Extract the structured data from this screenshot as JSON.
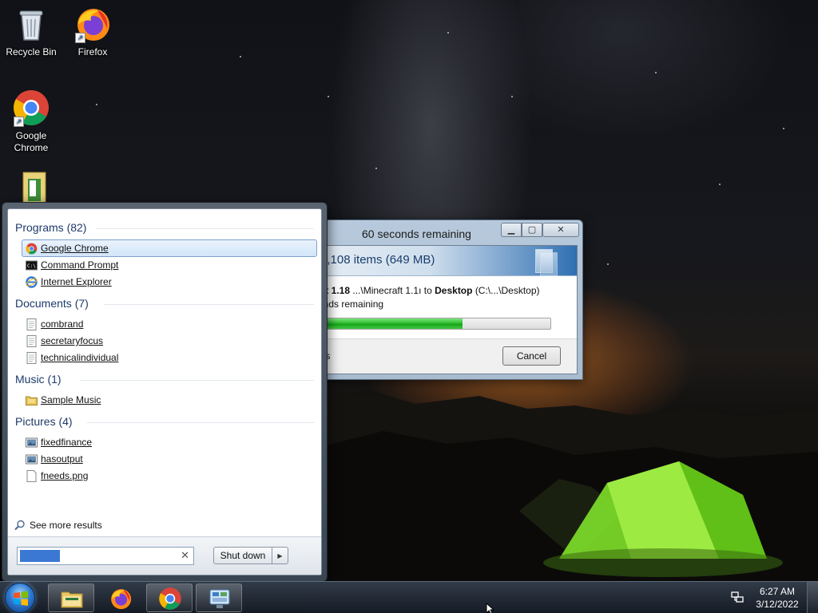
{
  "desktop": {
    "icons": [
      {
        "label": "Recycle Bin",
        "icon": "recycle-bin-icon"
      },
      {
        "label": "Firefox",
        "icon": "firefox-icon"
      },
      {
        "label": "Google Chrome",
        "icon": "chrome-icon"
      },
      {
        "label": "",
        "icon": "folder-icon"
      }
    ]
  },
  "copy_dialog": {
    "title": "60 seconds remaining",
    "heading": "4,108 items (649 MB)",
    "route": {
      "prefix": "raft 1.18",
      "source": "...\\Minecraft 1.1ı",
      "connector": "to",
      "destination": "Desktop",
      "destination_path": "(C:\\...\\Desktop)"
    },
    "remaining": "conds remaining",
    "progress_fraction": 0.63,
    "more_details": "tails",
    "cancel_label": "Cancel",
    "caption_buttons": {
      "minimize": "minimize-icon",
      "maximize": "maximize-icon",
      "close": "close-icon"
    }
  },
  "start_menu": {
    "groups": [
      {
        "header": "Programs (82)",
        "items": [
          {
            "label": "Google Chrome",
            "icon": "chrome-icon",
            "selected": true
          },
          {
            "label": "Command Prompt",
            "icon": "command-prompt-icon"
          },
          {
            "label": "Internet Explorer",
            "icon": "internet-explorer-icon"
          }
        ]
      },
      {
        "header": "Documents (7)",
        "items": [
          {
            "label": "combrand",
            "icon": "document-icon"
          },
          {
            "label": "secretaryfocus",
            "icon": "document-icon"
          },
          {
            "label": "technicalindividual",
            "icon": "document-icon"
          }
        ]
      },
      {
        "header": "Music (1)",
        "items": [
          {
            "label": "Sample Music",
            "icon": "folder-icon"
          }
        ]
      },
      {
        "header": "Pictures (4)",
        "items": [
          {
            "label": "fixedfinance",
            "icon": "image-icon"
          },
          {
            "label": "hasoutput",
            "icon": "image-icon"
          },
          {
            "label": "fneeds.png",
            "icon": "blank-file-icon"
          }
        ]
      }
    ],
    "see_more": "See more results",
    "search": {
      "value": "",
      "clear_icon": "clear-icon"
    },
    "shutdown_label": "Shut down",
    "shutdown_arrow": "▶"
  },
  "taskbar": {
    "pinned": [
      {
        "name": "file-explorer",
        "icon": "file-explorer-icon",
        "active": true
      },
      {
        "name": "firefox",
        "icon": "firefox-icon"
      },
      {
        "name": "chrome",
        "icon": "chrome-icon",
        "active": true
      },
      {
        "name": "control-panel",
        "icon": "control-panel-icon",
        "active": true
      }
    ],
    "tray_icon": "network-icon",
    "time": "6:27 AM",
    "date": "3/12/2022"
  }
}
